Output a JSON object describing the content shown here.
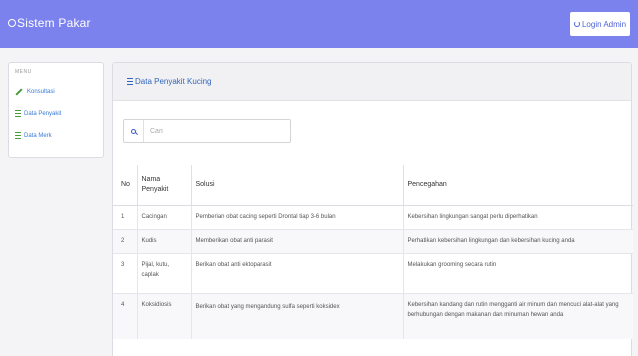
{
  "app": {
    "brand": "Sistem Pakar",
    "login_label": "Login Admin"
  },
  "sidebar": {
    "menu_label": "MENU",
    "items": [
      {
        "label": "Konsultasi",
        "icon": "pencil-icon"
      },
      {
        "label": "Data Penyakit",
        "icon": "list-icon"
      },
      {
        "label": "Data Merk",
        "icon": "list-icon"
      }
    ]
  },
  "panel": {
    "title": "Data Penyakit Kucing"
  },
  "search": {
    "placeholder": "Cari"
  },
  "table": {
    "headers": {
      "no": "No",
      "nama": "Nama Penyakit",
      "solusi": "Solusi",
      "pencegahan": "Pencegahan"
    },
    "rows": [
      {
        "no": "1",
        "nama": "Cacingan",
        "solusi": "Pemberian obat cacing seperti Drontal tiap 3-6 bulan",
        "pencegahan": "Kebersihan lingkungan sangat perlu diperhatikan"
      },
      {
        "no": "2",
        "nama": "Kudis",
        "solusi": "Memberikan obat anti parasit",
        "pencegahan": "Perhatikan kebersihan lingkungan dan kebersihan kucing anda"
      },
      {
        "no": "3",
        "nama": "Pijal, kutu, caplak",
        "solusi": "Berikan obat anti ektoparasit",
        "pencegahan": "Melakukan grooming secara rutin"
      },
      {
        "no": "4",
        "nama": "Koksidiosis",
        "solusi": "Berikan obat yang mengandung sulfa seperti koksidex",
        "pencegahan": "Kebersihan kandang dan rutin mengganti air minum dan mencuci alat-alat yang berhubungan dengan makanan dan minuman hewan anda"
      }
    ]
  },
  "colors": {
    "navbar": "#7b82ee",
    "link": "#3366bb",
    "icon_green": "#4a9c3a"
  }
}
